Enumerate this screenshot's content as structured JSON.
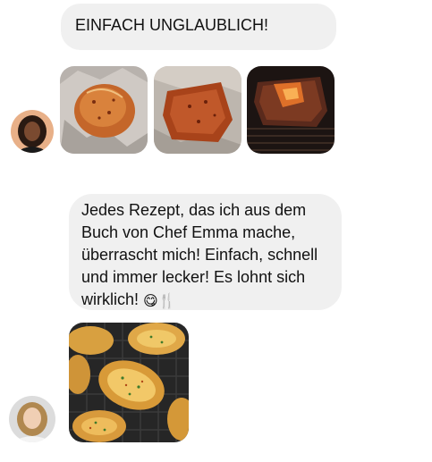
{
  "chat": {
    "messages": [
      {
        "sender_avatar": "woman-dark-hair-avatar",
        "text": "EINFACH UNGLAUBLICH!",
        "images": [
          "seasoned-meat-on-foil-photo",
          "rubbed-meat-on-foil-photo",
          "seared-meat-on-grill-photo"
        ]
      },
      {
        "sender_avatar": "woman-blonde-hair-avatar",
        "text_lines": [
          "Jedes Rezept, das ich aus dem",
          "Buch von Chef Emma mache,",
          "überrascht mich! Einfach, schnell",
          "und immer lecker! Es lohnt sich",
          "wirklich!"
        ],
        "emoji": [
          "😋",
          "🍴"
        ],
        "images": [
          "smashed-potatoes-in-air-fryer-photo"
        ]
      }
    ]
  },
  "colors": {
    "bubble_background": "#f0f0f0",
    "text": "#111111",
    "page_background": "#ffffff"
  }
}
